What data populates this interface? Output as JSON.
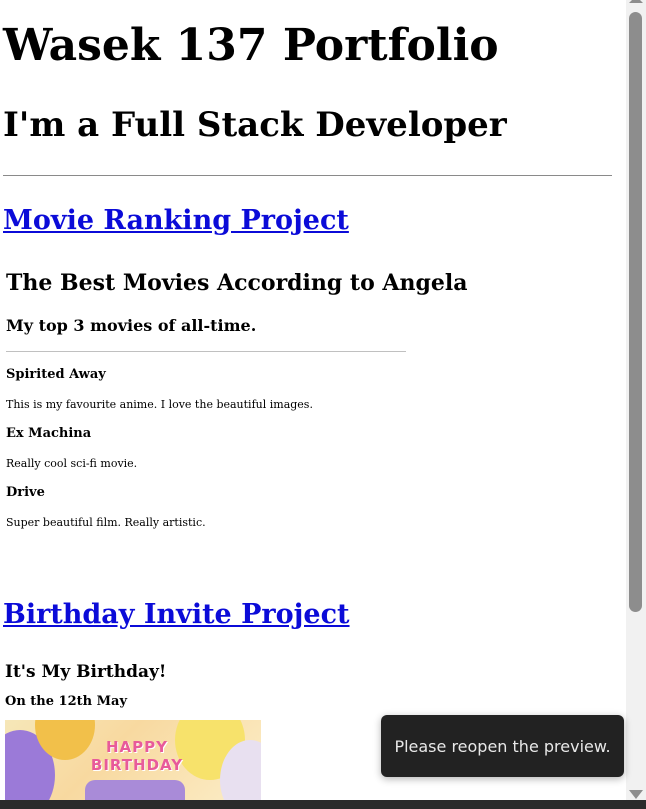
{
  "header": {
    "title": "Wasek 137 Portfolio",
    "subtitle": "I'm a Full Stack Developer"
  },
  "projects": [
    {
      "link_label": "Movie Ranking Project",
      "preview": {
        "heading": "The Best Movies According to Angela",
        "subheading": "My top 3 movies of all-time.",
        "movies": [
          {
            "title": "Spirited Away",
            "description": "This is my favourite anime. I love the beautiful images."
          },
          {
            "title": "Ex Machina",
            "description": "Really cool sci-fi movie."
          },
          {
            "title": "Drive",
            "description": "Super beautiful film. Really artistic."
          }
        ]
      }
    },
    {
      "link_label": "Birthday Invite Project",
      "preview": {
        "heading": "It's My Birthday!",
        "subheading": "On the 12th May",
        "image_text": "HAPPY BIRTHDAY"
      }
    }
  ],
  "toast": {
    "message": "Please reopen the preview."
  },
  "colors": {
    "link": "#0b0bd8",
    "toast_bg": "#222222",
    "scroll_thumb": "#8d8d8d"
  }
}
